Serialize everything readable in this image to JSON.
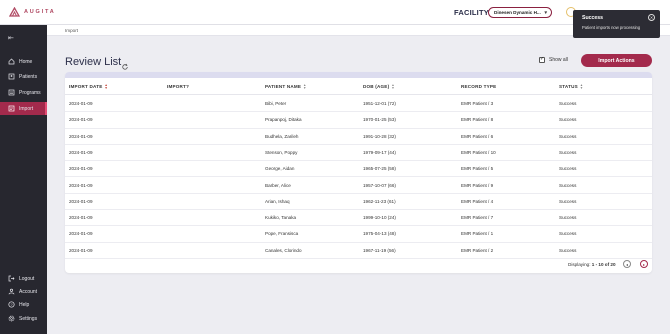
{
  "app": {
    "logo_text": "AUGITA",
    "brand_color": "#a32a4c"
  },
  "header": {
    "facility_label": "FACILITY",
    "facility_value": "Dinesen Dynamic H..."
  },
  "sidebar": {
    "items": [
      {
        "label": "Home",
        "icon": "home-icon"
      },
      {
        "label": "Patients",
        "icon": "patients-icon"
      },
      {
        "label": "Programs",
        "icon": "programs-icon"
      },
      {
        "label": "Import",
        "icon": "import-icon",
        "active": true
      }
    ],
    "bottom_items": [
      {
        "label": "Logout",
        "icon": "logout-icon"
      },
      {
        "label": "Account",
        "icon": "account-icon"
      },
      {
        "label": "Help",
        "icon": "help-icon"
      },
      {
        "label": "Settings",
        "icon": "settings-icon"
      }
    ]
  },
  "breadcrumb": {
    "current": "Import"
  },
  "page": {
    "title": "Review List",
    "show_all_label": "Show all",
    "show_all_checked": true,
    "import_actions_label": "Import Actions"
  },
  "table": {
    "headers": {
      "import_date": "IMPORT DATE",
      "import": "IMPORT?",
      "patient_name": "PATIENT NAME",
      "dob": "DOB (AGE)",
      "record_type": "RECORD TYPE",
      "status": "STATUS"
    },
    "rows": [
      {
        "date": "2024-01-09",
        "import": "",
        "name": "Bibi, Peter",
        "dob": "1951-12-01 (72)",
        "record": "EMR Patient / 3",
        "status": "Success"
      },
      {
        "date": "2024-01-09",
        "import": "",
        "name": "Prapanpoj, Ditaka",
        "dob": "1970-01-25 (53)",
        "record": "EMR Patient / 8",
        "status": "Success"
      },
      {
        "date": "2024-01-09",
        "import": "",
        "name": "Budhela, Zarileh",
        "dob": "1991-10-28 (32)",
        "record": "EMR Patient / 6",
        "status": "Success"
      },
      {
        "date": "2024-01-09",
        "import": "",
        "name": "Stenson, Poppy",
        "dob": "1979-09-17 (44)",
        "record": "EMR Patient / 10",
        "status": "Success"
      },
      {
        "date": "2024-01-09",
        "import": "",
        "name": "George, Aidan",
        "dob": "1965-07-25 (58)",
        "record": "EMR Patient / 5",
        "status": "Success"
      },
      {
        "date": "2024-01-09",
        "import": "",
        "name": "Barber, Alice",
        "dob": "1957-10-07 (66)",
        "record": "EMR Patient / 9",
        "status": "Success"
      },
      {
        "date": "2024-01-09",
        "import": "",
        "name": "Arian, Ishaq",
        "dob": "1962-11-23 (61)",
        "record": "EMR Patient / 4",
        "status": "Success"
      },
      {
        "date": "2024-01-09",
        "import": "",
        "name": "Kukiko, Tanaka",
        "dob": "1999-10-10 (24)",
        "record": "EMR Patient / 7",
        "status": "Success"
      },
      {
        "date": "2024-01-09",
        "import": "",
        "name": "Pope, Fransisca",
        "dob": "1975-04-13 (48)",
        "record": "EMR Patient / 1",
        "status": "Success"
      },
      {
        "date": "2024-01-09",
        "import": "",
        "name": "Canales, Clorindo",
        "dob": "1967-11-19 (56)",
        "record": "EMR Patient / 2",
        "status": "Success"
      }
    ],
    "footer": {
      "prefix": "Displaying: ",
      "range": "1 - 10 of 20"
    }
  },
  "toast": {
    "title": "Success",
    "message": "Patient imports now processing"
  }
}
